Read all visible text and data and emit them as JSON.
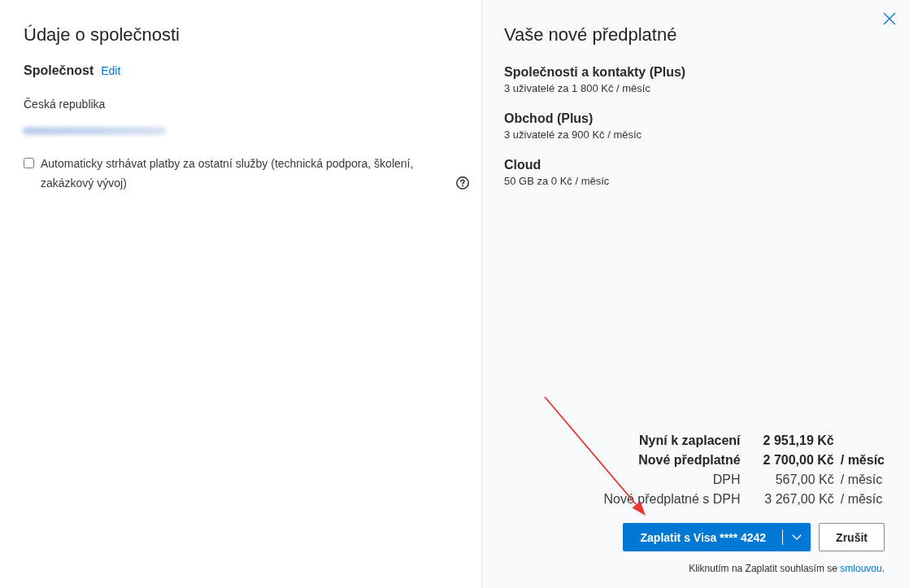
{
  "company_panel": {
    "title": "Údaje o společnosti",
    "company": {
      "label": "Společnost",
      "edit_link": "Edit"
    },
    "country": "Česká republika",
    "autopay": {
      "label": "Automaticky strhávat platby za ostatní služby (technická podpora, školení, zakázkový vývoj)",
      "checked": false
    }
  },
  "subscription_panel": {
    "title": "Vaše nové předplatné",
    "items": [
      {
        "name": "Společnosti a kontakty (Plus)",
        "detail": "3 uživatelé za 1 800 Kč / měsíc"
      },
      {
        "name": "Obchod (Plus)",
        "detail": "3 uživatelé za 900 Kč / měsíc"
      },
      {
        "name": "Cloud",
        "detail": "50 GB za 0 Kč / měsíc"
      }
    ],
    "summary": [
      {
        "kind": "total",
        "label": "Nyní k zaplacení",
        "amount": "2 951,19 Kč"
      },
      {
        "kind": "total",
        "label": "Nové předplatné",
        "amount": "2 700,00 Kč",
        "period": "/ měsíc"
      },
      {
        "kind": "detail",
        "label": "DPH",
        "amount": "567,00 Kč",
        "period": "/ měsíc"
      },
      {
        "kind": "detail",
        "label": "Nové předplatné s DPH",
        "amount": "3 267,00 Kč",
        "period": "/ měsíc"
      }
    ],
    "pay_button": {
      "label": "Zaplatit s Visa **** 4242"
    },
    "cancel_button": {
      "label": "Zrušit"
    },
    "agreement": {
      "text": "Kliknutím na Zaplatit souhlasím se",
      "link": "smlouvou",
      "end": "."
    }
  }
}
